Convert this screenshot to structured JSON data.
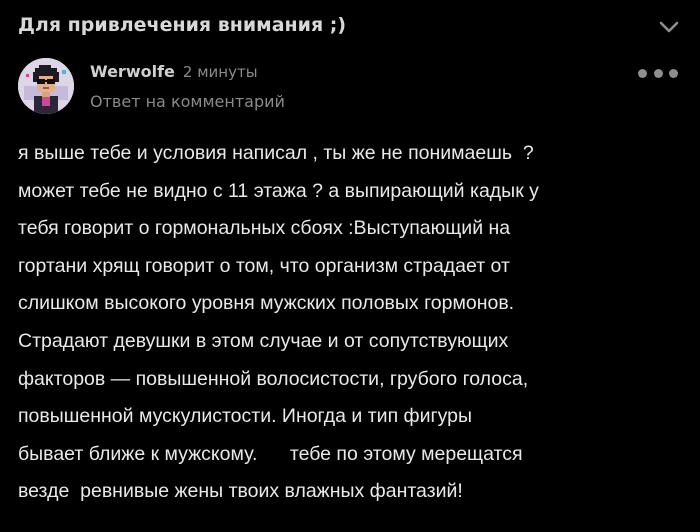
{
  "post": {
    "title": "Для привлечения внимания ;)",
    "collapse_icon": "chevron-down-icon"
  },
  "comment": {
    "author": "Werwolfe",
    "time": "2 минуты",
    "reply_label": "Ответ на комментарий",
    "more_icon": "more-dots-icon",
    "avatar_icon": "user-avatar-pixel-art",
    "lines": [
      "я выше тебе и условия написал , ты же не понимаешь  ?",
      "может тебе не видно с 11 этажа ? а выпирающий кадык у",
      "тебя говорит о гормональных сбоях :Выступающий на",
      "гортани хрящ говорит о том, что организм страдает от",
      "слишком высокого уровня мужских половых гормонов.",
      "Страдают девушки в этом случае и от сопутствующих",
      "факторов — повышенной волосистости, грубого голоса,",
      "повышенной мускулистости. Иногда и тип фигуры",
      "бывает ближе к мужскому.      тебе по этому мерещатся",
      "везде  ревнивые жены твоих влажных фантазий!"
    ]
  },
  "colors": {
    "background": "#000000",
    "text_primary": "#e9e9e9",
    "text_secondary": "#8a8a8a",
    "icon_gray": "#8e8e8e"
  }
}
